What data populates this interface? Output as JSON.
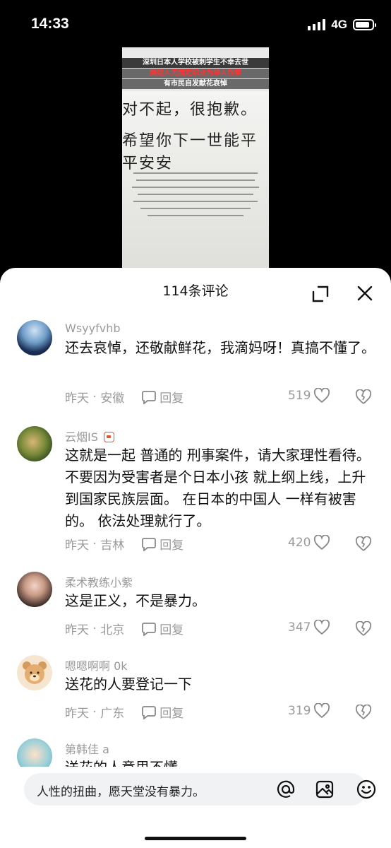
{
  "status_bar": {
    "time": "14:33",
    "network": "4G",
    "battery_level": 0.85
  },
  "video": {
    "caption_line1": "深圳日本人学校被刺学生不幸去世",
    "caption_line2": "嫌疑人无固定职业为单人作案",
    "caption_line3": "有市民自发献花哀悼",
    "handwriting_line1": "对不起，很抱歉。",
    "handwriting_line2": "希望你下一世能平平安安"
  },
  "sheet": {
    "title": "114条评论",
    "expand_icon": "expand-icon",
    "close_icon": "close-icon"
  },
  "comments": [
    {
      "username": "Wsyyfvhb",
      "text": "还去哀悼，还敬献鲜花，我滴妈呀！真搞不懂了。",
      "time": "昨天",
      "location": "安徽",
      "reply_label": "回复",
      "likes": "519"
    },
    {
      "username": "云烟IS",
      "text": "这就是一起 普通的 刑事案件，请大家理性看待。不要因为受害者是个日本小孩 就上纲上线，上升到国家民族层面。 在日本的中国人 一样有被害的。 依法处理就行了。",
      "time": "昨天",
      "location": "吉林",
      "reply_label": "回复",
      "likes": "420"
    },
    {
      "username": "柔术教练小紫",
      "text": "这是正义，不是暴力。",
      "time": "昨天",
      "location": "北京",
      "reply_label": "回复",
      "likes": "347"
    },
    {
      "username": "嗯嗯啊啊 0k",
      "text": "送花的人要登记一下",
      "time": "昨天",
      "location": "广东",
      "reply_label": "回复",
      "likes": "319"
    },
    {
      "username": "第韩佳 a",
      "text": "送花的人意思不懂",
      "time": "",
      "location": "",
      "reply_label": "",
      "likes": ""
    }
  ],
  "input": {
    "text": "人性的扭曲，愿天堂没有暴力。"
  }
}
